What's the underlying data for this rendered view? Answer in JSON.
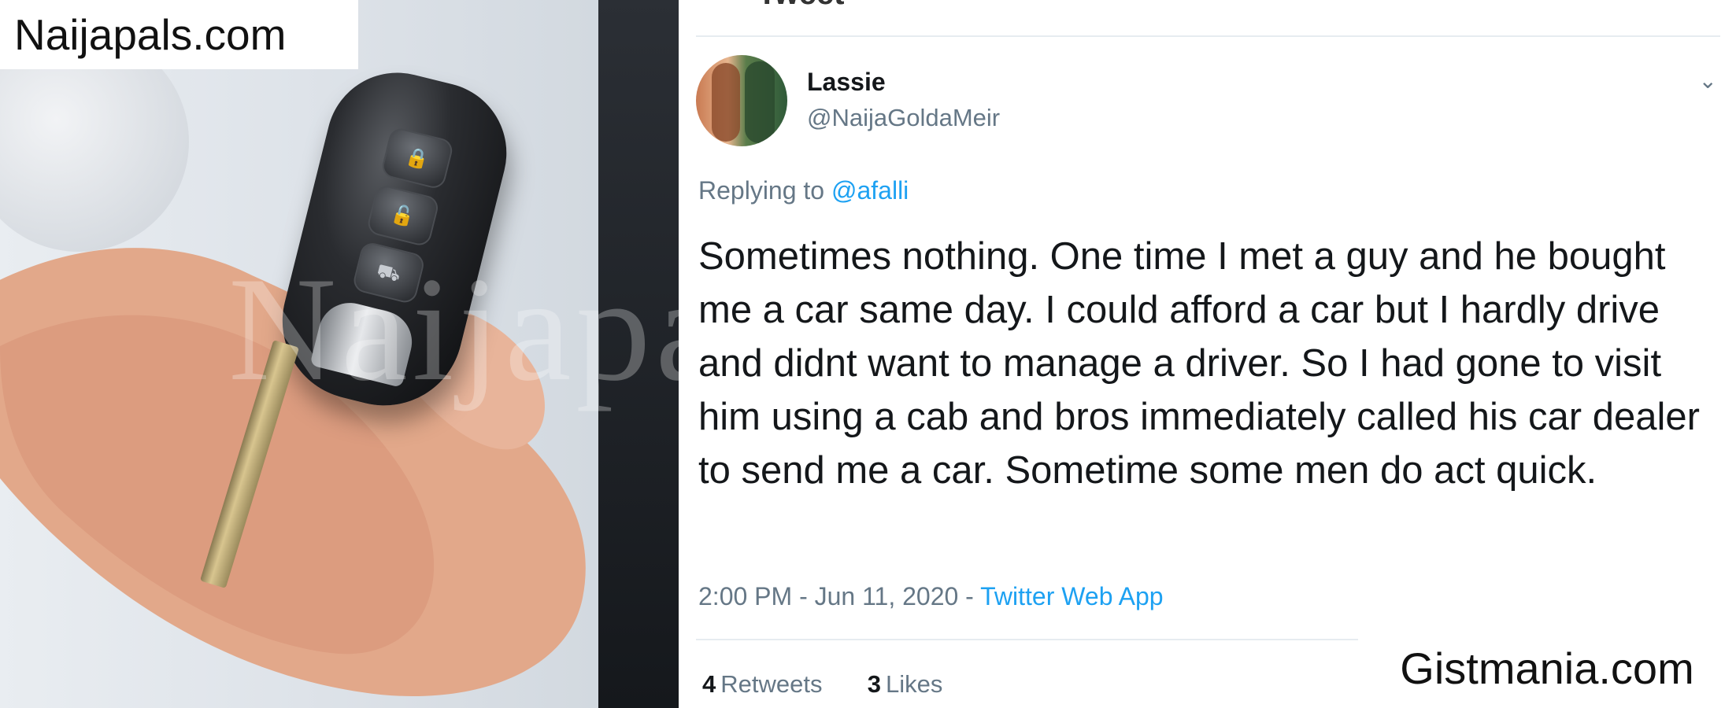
{
  "watermarks": {
    "top_left": "Naijapals.com",
    "bottom_right": "Gistmania.com",
    "overlay": "Naijapals.com"
  },
  "photo": {
    "subject": "car-key-fob-in-hand",
    "fob_buttons": [
      "lock-icon",
      "unlock-icon",
      "trunk-icon"
    ]
  },
  "tweet": {
    "header_cut": "Tweet",
    "user": {
      "display_name": "Lassie",
      "handle": "@NaijaGoldaMeir"
    },
    "replying_prefix": "Replying to ",
    "replying_to": "@afalli",
    "text": "Sometimes nothing. One time I met a guy and he bought me a car same day. I could afford a car but I hardly drive and didnt want to manage a driver. So I had gone to visit him using a cab and bros immediately called his car dealer to send me a car. Sometime some men do act quick.",
    "time": "2:00 PM - Jun 11, 2020 - ",
    "app": "Twitter Web App",
    "retweets_count": "4",
    "retweets_label": "Retweets",
    "likes_count": "3",
    "likes_label": "Likes"
  },
  "colors": {
    "link": "#1da1f2",
    "secondary": "#657786",
    "text": "#14171a"
  }
}
